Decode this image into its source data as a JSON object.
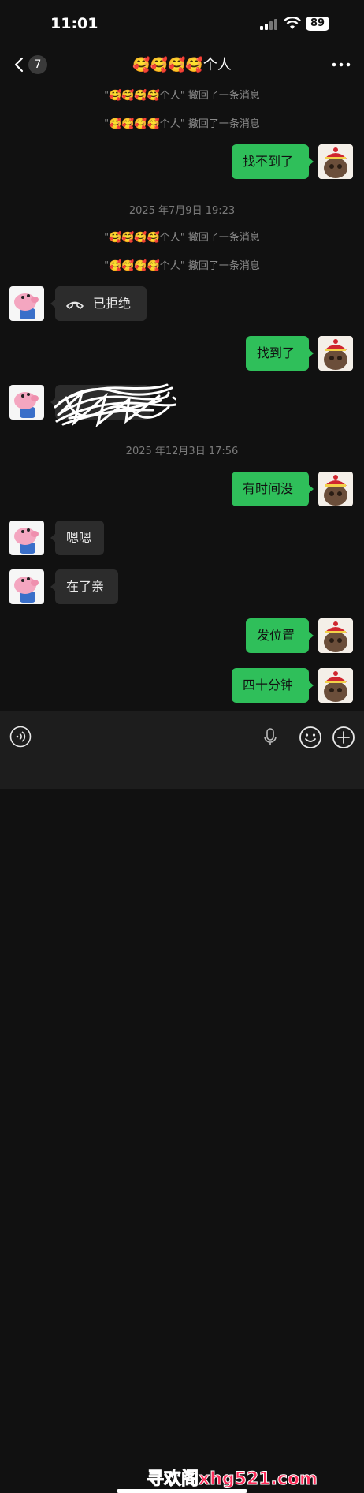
{
  "status": {
    "time": "11:01",
    "battery": "89"
  },
  "nav": {
    "unread": "7",
    "title": "🥰🥰🥰🥰个人"
  },
  "recalled_text": "\"🥰🥰🥰🥰个人\" 撤回了一条消息",
  "timestamps": {
    "t1": "2025 年7月9日 19:23",
    "t2": "2025 年12月3日 17:56"
  },
  "messages": {
    "m1": "找不到了",
    "m2": "已拒绝",
    "m3": "找到了",
    "m5": "有时间没",
    "m6": "嗯嗯",
    "m7": "在了亲",
    "m8": "发位置",
    "m9": "四十分钟"
  },
  "watermark": "寻欢阁xhg521.com",
  "colors": {
    "bubble_me": "#2fbf5a",
    "bubble_other": "#2c2c2c",
    "background": "#111111"
  },
  "icons": [
    "back-chevron-icon",
    "more-icon",
    "call-declined-icon",
    "voice-icon",
    "mic-icon",
    "emoji-icon",
    "plus-icon",
    "pig-avatar",
    "cat-avatar"
  ]
}
